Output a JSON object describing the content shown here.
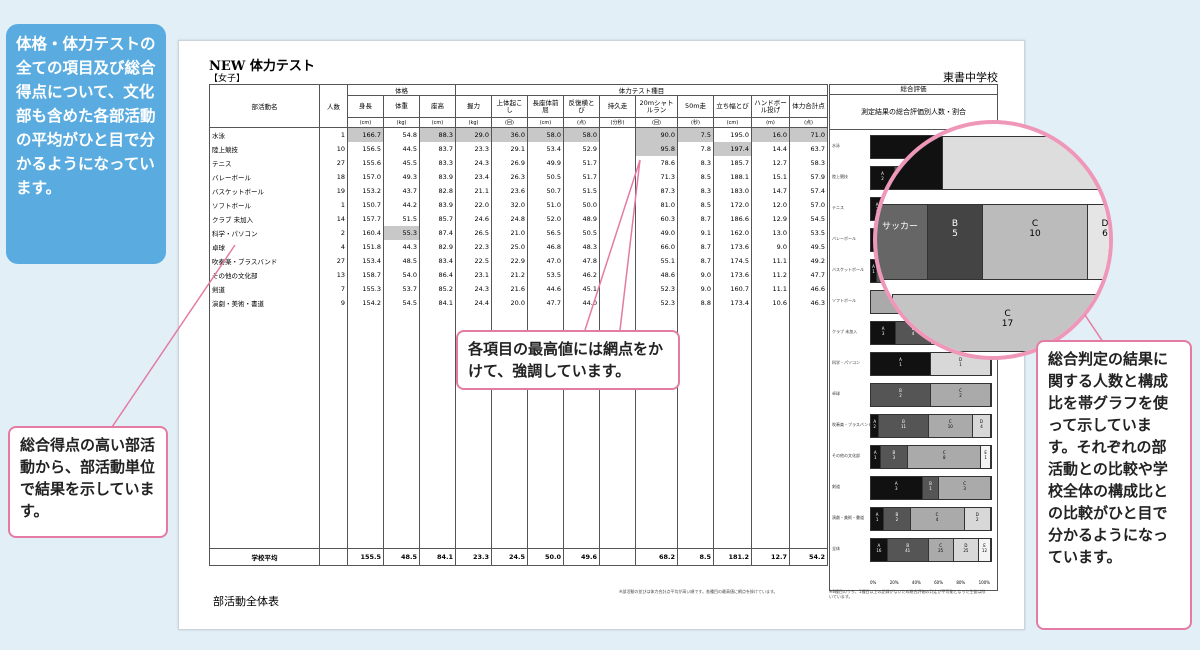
{
  "sheet": {
    "title": "NEW 体力テスト",
    "subtitle": "【女子】",
    "school": "東書中学校",
    "footer": "部活動全体表",
    "note_left": "※部活動の並びは体力合計点平均が高い順です。各種目の最高値に網点を掛けています。",
    "note_right": "※8種目のうち、1種目以上の記録がないため総合評価の判定が不可能となった生徒は除いています。"
  },
  "table": {
    "group_physique": "体格",
    "group_tests": "体力テスト種目",
    "group_eval": "総合評価",
    "eval_header": "測定結果の総合評価別人数・割合",
    "col_club": "部活動名",
    "col_count": "人数",
    "columns": [
      "身長",
      "体重",
      "座高",
      "握力",
      "上体起こし",
      "長座体前屈",
      "反復横とび",
      "持久走",
      "20mシャトルラン",
      "50m走",
      "立ち幅とび",
      "ハンドボール投げ",
      "体力合計点"
    ],
    "units": [
      "(cm)",
      "(kg)",
      "(cm)",
      "(kg)",
      "(回)",
      "(cm)",
      "(点)",
      "(分秒)",
      "(回)",
      "(秒)",
      "(cm)",
      "(m)",
      "(点)"
    ],
    "rows": [
      {
        "name": "水泳",
        "n": "1",
        "v": [
          "166.7",
          "54.8",
          "88.3",
          "29.0",
          "36.0",
          "58.0",
          "58.0",
          "",
          "90.0",
          "7.5",
          "195.0",
          "16.0",
          "71.0"
        ],
        "hl": [
          0,
          2,
          3,
          4,
          5,
          6,
          8,
          9,
          11,
          12
        ]
      },
      {
        "name": "陸上競技",
        "n": "10",
        "v": [
          "156.5",
          "44.5",
          "83.7",
          "23.3",
          "29.1",
          "53.4",
          "52.9",
          "",
          "95.8",
          "7.8",
          "197.4",
          "14.4",
          "63.7"
        ],
        "hl": [
          8,
          10
        ]
      },
      {
        "name": "テニス",
        "n": "27",
        "v": [
          "155.6",
          "45.5",
          "83.3",
          "24.3",
          "26.9",
          "49.9",
          "51.7",
          "",
          "78.6",
          "8.3",
          "185.7",
          "12.7",
          "58.3"
        ],
        "hl": []
      },
      {
        "name": "バレーボール",
        "n": "18",
        "v": [
          "157.0",
          "49.3",
          "83.9",
          "23.4",
          "26.3",
          "50.5",
          "51.7",
          "",
          "71.3",
          "8.5",
          "188.1",
          "15.1",
          "57.9"
        ],
        "hl": []
      },
      {
        "name": "バスケットボール",
        "n": "19",
        "v": [
          "153.2",
          "43.7",
          "82.8",
          "21.1",
          "23.6",
          "50.7",
          "51.5",
          "",
          "87.3",
          "8.3",
          "183.0",
          "14.7",
          "57.4"
        ],
        "hl": []
      },
      {
        "name": "ソフトボール",
        "n": "1",
        "v": [
          "150.7",
          "44.2",
          "83.9",
          "22.0",
          "32.0",
          "51.0",
          "50.0",
          "",
          "81.0",
          "8.5",
          "172.0",
          "12.0",
          "57.0"
        ],
        "hl": []
      },
      {
        "name": "クラブ 未加入",
        "n": "14",
        "v": [
          "157.7",
          "51.5",
          "85.7",
          "24.6",
          "24.8",
          "52.0",
          "48.9",
          "",
          "60.3",
          "8.7",
          "186.6",
          "12.9",
          "54.5"
        ],
        "hl": []
      },
      {
        "name": "科学・パソコン",
        "n": "2",
        "v": [
          "160.4",
          "55.3",
          "87.4",
          "26.5",
          "21.0",
          "56.5",
          "50.5",
          "",
          "49.0",
          "9.1",
          "162.0",
          "13.0",
          "53.5"
        ],
        "hl": [
          1
        ]
      },
      {
        "name": "卓球",
        "n": "4",
        "v": [
          "151.8",
          "44.3",
          "82.9",
          "22.3",
          "25.0",
          "46.8",
          "48.3",
          "",
          "66.0",
          "8.7",
          "173.6",
          "9.0",
          "49.5"
        ],
        "hl": []
      },
      {
        "name": "吹奏楽・ブラスバンド",
        "n": "27",
        "v": [
          "153.4",
          "48.5",
          "83.4",
          "22.5",
          "22.9",
          "47.0",
          "47.8",
          "",
          "55.1",
          "8.7",
          "174.5",
          "11.1",
          "49.2"
        ],
        "hl": []
      },
      {
        "name": "その他の文化部",
        "n": "13",
        "v": [
          "158.7",
          "54.0",
          "86.4",
          "23.1",
          "21.2",
          "53.5",
          "46.2",
          "",
          "48.6",
          "9.0",
          "173.6",
          "11.2",
          "47.7"
        ],
        "hl": []
      },
      {
        "name": "剣道",
        "n": "7",
        "v": [
          "155.3",
          "53.7",
          "85.2",
          "24.3",
          "21.6",
          "44.6",
          "45.1",
          "",
          "52.3",
          "9.0",
          "160.7",
          "11.1",
          "46.6"
        ],
        "hl": []
      },
      {
        "name": "演劇・美術・書道",
        "n": "9",
        "v": [
          "154.2",
          "54.5",
          "84.1",
          "24.4",
          "20.0",
          "47.7",
          "44.0",
          "",
          "52.3",
          "8.8",
          "173.4",
          "10.6",
          "46.3"
        ],
        "hl": []
      }
    ],
    "avg": {
      "name": "学校平均",
      "v": [
        "155.5",
        "48.5",
        "84.1",
        "23.3",
        "24.5",
        "50.0",
        "49.6",
        "",
        "68.2",
        "8.5",
        "181.2",
        "12.7",
        "54.2"
      ]
    }
  },
  "eval_bars": [
    {
      "label": "水泳",
      "segs": [
        [
          "A",
          "1",
          100
        ]
      ]
    },
    {
      "label": "陸上競技",
      "segs": [
        [
          "A",
          "2",
          20
        ],
        [
          "B",
          "5",
          50
        ],
        [
          "C",
          "3",
          30
        ]
      ]
    },
    {
      "label": "テニス",
      "segs": [
        [
          "A",
          "3",
          11
        ],
        [
          "B",
          "10",
          37
        ],
        [
          "C",
          "11",
          41
        ],
        [
          "D",
          "3",
          11
        ]
      ]
    },
    {
      "label": "バレーボール",
      "segs": [
        [
          "A",
          "2",
          11
        ],
        [
          "B",
          "7",
          39
        ],
        [
          "C",
          "8",
          44
        ],
        [
          "D",
          "1",
          6
        ]
      ]
    },
    {
      "label": "バスケットボール",
      "segs": [
        [
          "A",
          "1",
          5
        ],
        [
          "B",
          "8",
          42
        ],
        [
          "C",
          "8",
          42
        ],
        [
          "D",
          "2",
          11
        ]
      ]
    },
    {
      "label": "ソフトボール",
      "segs": [
        [
          "C",
          "1",
          100
        ]
      ]
    },
    {
      "label": "クラブ 未加入",
      "segs": [
        [
          "A",
          "3",
          21
        ],
        [
          "B",
          "4",
          29
        ],
        [
          "C",
          "5",
          36
        ],
        [
          "D",
          "2",
          14
        ]
      ]
    },
    {
      "label": "科学・パソコン",
      "segs": [
        [
          "A",
          "1",
          50
        ],
        [
          "D",
          "1",
          50
        ]
      ]
    },
    {
      "label": "卓球",
      "segs": [
        [
          "B",
          "2",
          50
        ],
        [
          "C",
          "2",
          50
        ]
      ]
    },
    {
      "label": "吹奏楽・ブラスバンド",
      "segs": [
        [
          "A",
          "2",
          7
        ],
        [
          "B",
          "11",
          41
        ],
        [
          "C",
          "10",
          37
        ],
        [
          "D",
          "4",
          15
        ]
      ]
    },
    {
      "label": "その他の文化部",
      "segs": [
        [
          "A",
          "1",
          8
        ],
        [
          "B",
          "3",
          23
        ],
        [
          "C",
          "8",
          61
        ],
        [
          "E",
          "1",
          8
        ]
      ]
    },
    {
      "label": "剣道",
      "segs": [
        [
          "A",
          "3",
          43
        ],
        [
          "B",
          "1",
          14
        ],
        [
          "C",
          "3",
          43
        ]
      ]
    },
    {
      "label": "演劇・美術・書道",
      "segs": [
        [
          "A",
          "1",
          11
        ],
        [
          "B",
          "2",
          22
        ],
        [
          "C",
          "4",
          45
        ],
        [
          "D",
          "2",
          22
        ]
      ]
    },
    {
      "label": "全体",
      "segs": [
        [
          "A",
          "16",
          14
        ],
        [
          "B",
          "41",
          34
        ],
        [
          "C",
          "25",
          21
        ],
        [
          "D",
          "25",
          21
        ],
        [
          "E",
          "12",
          10
        ]
      ]
    }
  ],
  "axis_ticks": [
    "0%",
    "20%",
    "40%",
    "60%",
    "80%",
    "100%"
  ],
  "zoom": {
    "rows": [
      {
        "label": "水泳"
      },
      {
        "label": "サッカー",
        "segs": [
          [
            "B",
            "5"
          ],
          [
            "C",
            "10"
          ],
          [
            "D",
            "6"
          ]
        ]
      },
      {
        "label": "ソフトボール",
        "segs": [
          [
            "C",
            "17"
          ]
        ]
      }
    ]
  },
  "callouts": {
    "blue": "体格・体力テストの全ての項目及び総合得点について、文化部も含めた各部活動の平均がひと目で分かるようになっています。",
    "left": "総合得点の高い部活動から、部活動単位で結果を示しています。",
    "mid": "各項目の最高値には網点をかけて、強調しています。",
    "right": "総合判定の結果に関する人数と構成比を帯グラフを使って示しています。それぞれの部活動との比較や学校全体の構成比との比較がひと目で分かるようになっています。"
  }
}
